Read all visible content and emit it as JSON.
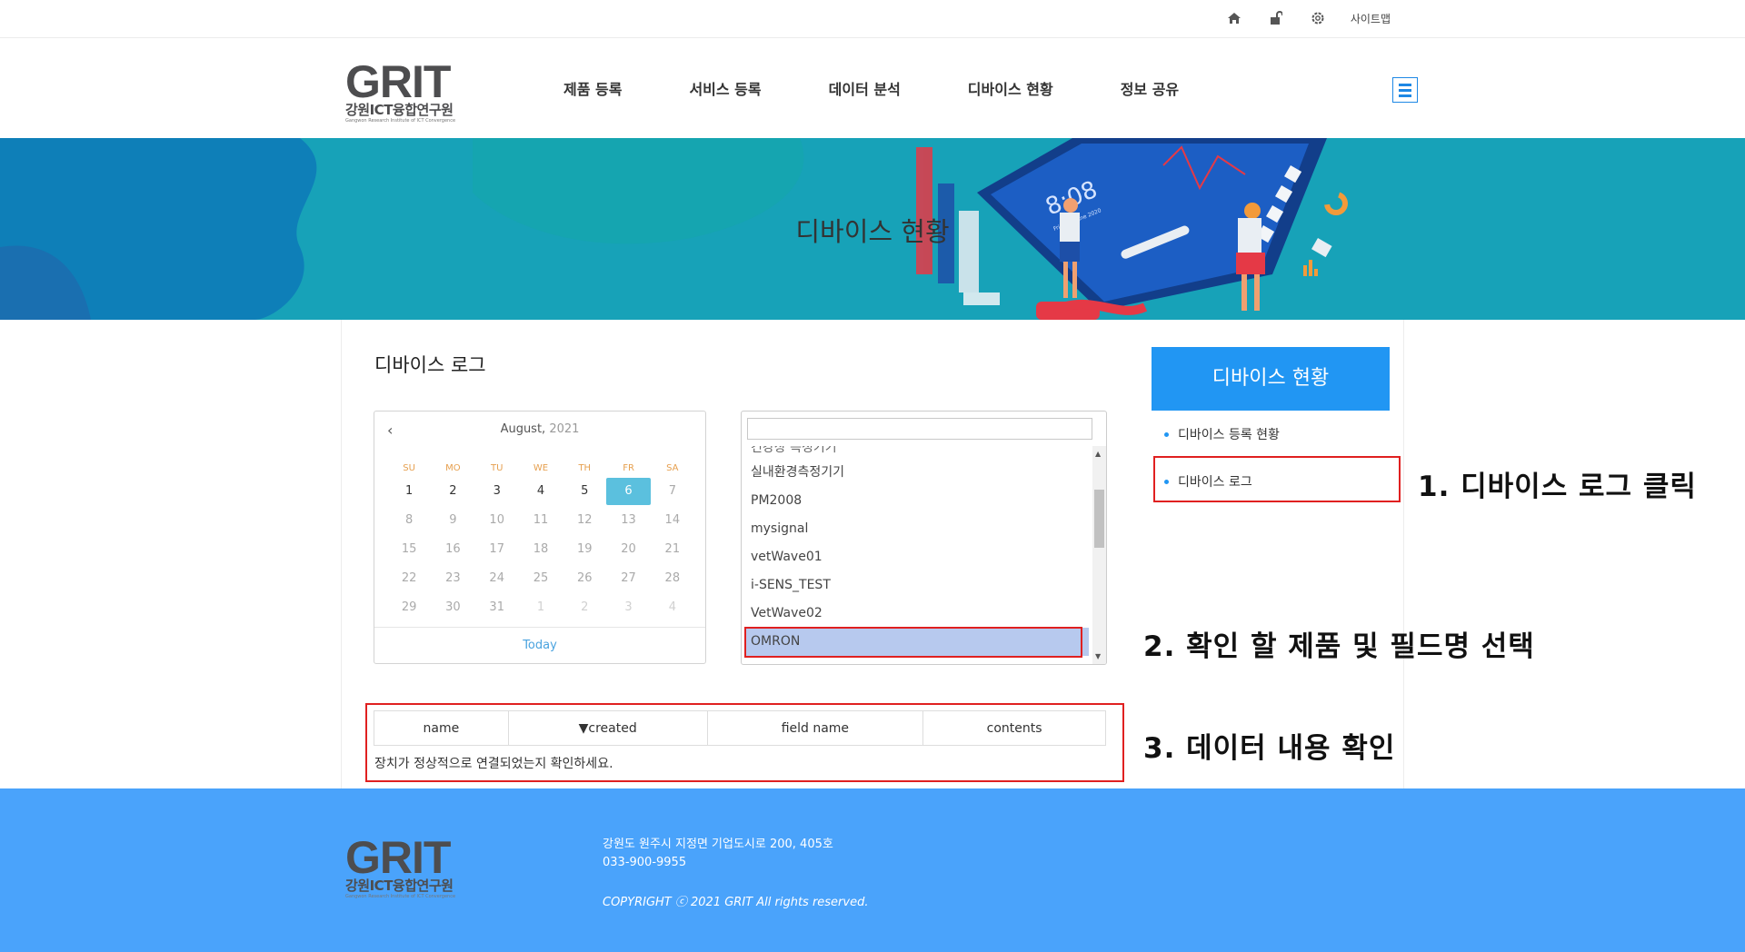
{
  "utilbar": {
    "icons": [
      "home-icon",
      "lock-open-icon",
      "gear-icon"
    ],
    "sitemap_label": "사이트맵"
  },
  "header": {
    "logo_word": "GRIT",
    "logo_sub": "강원ICT융합연구원",
    "logo_sub_en": "Gangwon Research Institute of ICT Convergence",
    "nav": [
      "제품 등록",
      "서비스 등록",
      "데이터 분석",
      "디바이스 현황",
      "정보 공유"
    ]
  },
  "banner": {
    "title": "디바이스 현황",
    "phone_time": "8:08",
    "phone_date": "Friday 2 June 2020"
  },
  "main": {
    "page_title": "디바이스 로그",
    "calendar": {
      "month": "August,",
      "year": "2021",
      "weekdays": [
        "SU",
        "MO",
        "TU",
        "WE",
        "TH",
        "FR",
        "SA"
      ],
      "weeks": [
        [
          "1",
          "2",
          "3",
          "4",
          "5",
          "6",
          "7"
        ],
        [
          "8",
          "9",
          "10",
          "11",
          "12",
          "13",
          "14"
        ],
        [
          "15",
          "16",
          "17",
          "18",
          "19",
          "20",
          "21"
        ],
        [
          "22",
          "23",
          "24",
          "25",
          "26",
          "27",
          "28"
        ],
        [
          "29",
          "30",
          "31",
          "1",
          "2",
          "3",
          "4"
        ]
      ],
      "selected": "6",
      "today_label": "Today"
    },
    "device_list": {
      "search_value": "",
      "partial_item": "건강상 측정기기",
      "items": [
        "실내환경측정기기",
        "PM2008",
        "mysignal",
        "vetWave01",
        "i-SENS_TEST",
        "VetWave02",
        "OMRON"
      ],
      "selected": "OMRON"
    },
    "table": {
      "columns": [
        "name",
        "▼created",
        "field name",
        "contents"
      ],
      "empty_message": "장치가 정상적으로 연결되었는지 확인하세요."
    }
  },
  "sidebar": {
    "heading": "디바이스 현황",
    "items": [
      "디바이스 등록 현황",
      "디바이스 로그"
    ]
  },
  "annotations": {
    "step1": "1. 디바이스 로그 클릭",
    "step2": "2. 확인 할 제품 및 필드명 선택",
    "step3": "3. 데이터 내용 확인"
  },
  "footer": {
    "address": "강원도 원주시 지정면 기업도시로 200, 405호",
    "phone": "033-900-9955",
    "copyright": "COPYRIGHT ⓒ 2021 GRIT All rights reserved."
  },
  "colors": {
    "primary_blue": "#2196f3",
    "footer_blue": "#4aa3fb",
    "banner_teal": "#17a2b8",
    "annotation_red": "#e02020",
    "selected_day": "#5bc0de",
    "selected_list_item": "#b7c9ee"
  }
}
